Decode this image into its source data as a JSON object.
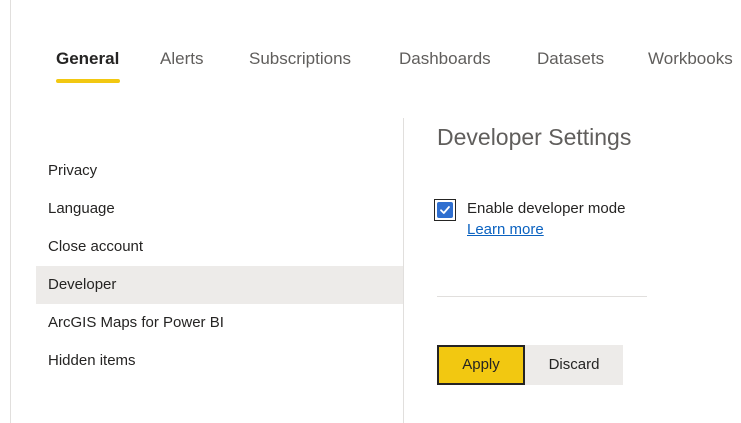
{
  "tabs": [
    {
      "label": "General"
    },
    {
      "label": "Alerts"
    },
    {
      "label": "Subscriptions"
    },
    {
      "label": "Dashboards"
    },
    {
      "label": "Datasets"
    },
    {
      "label": "Workbooks"
    }
  ],
  "active_tab": "General",
  "nav": {
    "items": [
      {
        "label": "Privacy"
      },
      {
        "label": "Language"
      },
      {
        "label": "Close account"
      },
      {
        "label": "Developer"
      },
      {
        "label": "ArcGIS Maps for Power BI"
      },
      {
        "label": "Hidden items"
      }
    ],
    "selected": "Developer"
  },
  "content": {
    "heading": "Developer Settings",
    "developer_mode_label": "Enable developer mode",
    "developer_mode_checked": true,
    "learn_more": "Learn more"
  },
  "buttons": {
    "apply": "Apply",
    "discard": "Discard"
  },
  "colors": {
    "accent": "#f2c811",
    "checkbox": "#2f6fd0",
    "link": "#0b62c0",
    "selected_bg": "#edebe9"
  }
}
